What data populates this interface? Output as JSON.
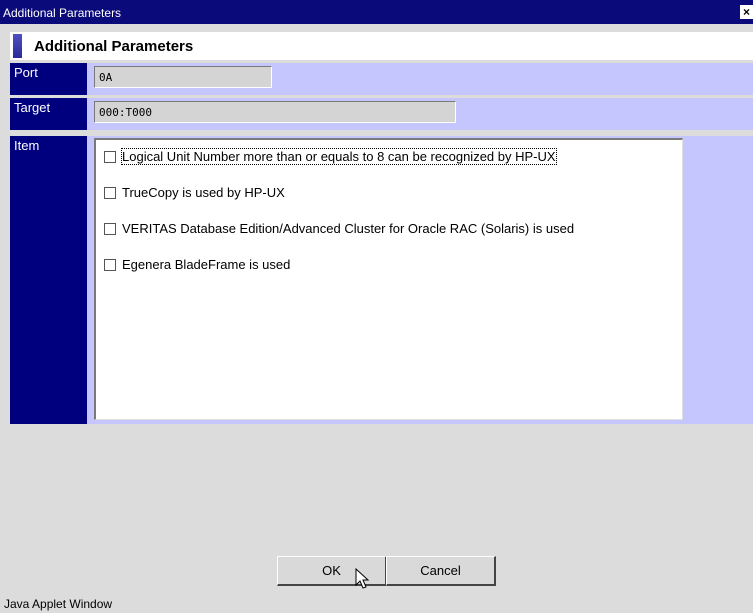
{
  "window": {
    "title": "Additional Parameters",
    "close_glyph": "×"
  },
  "header": {
    "title": "Additional Parameters"
  },
  "port": {
    "label": "Port",
    "value": "0A"
  },
  "target": {
    "label": "Target",
    "value": "000:T000"
  },
  "item": {
    "label": "Item",
    "options": [
      {
        "label": "Logical Unit Number more than or equals to 8 can be recognized by HP-UX",
        "checked": false
      },
      {
        "label": "TrueCopy is used by HP-UX",
        "checked": false
      },
      {
        "label": "VERITAS Database Edition/Advanced Cluster for Oracle RAC (Solaris) is used",
        "checked": false
      },
      {
        "label": "Egenera BladeFrame is used",
        "checked": false
      }
    ]
  },
  "buttons": {
    "ok": "OK",
    "cancel": "Cancel"
  },
  "status": {
    "text": "Java Applet Window"
  },
  "colors": {
    "titlebar": "#0a0a7a",
    "label_bg": "#00007e",
    "row_bg": "#c6c6ff"
  }
}
